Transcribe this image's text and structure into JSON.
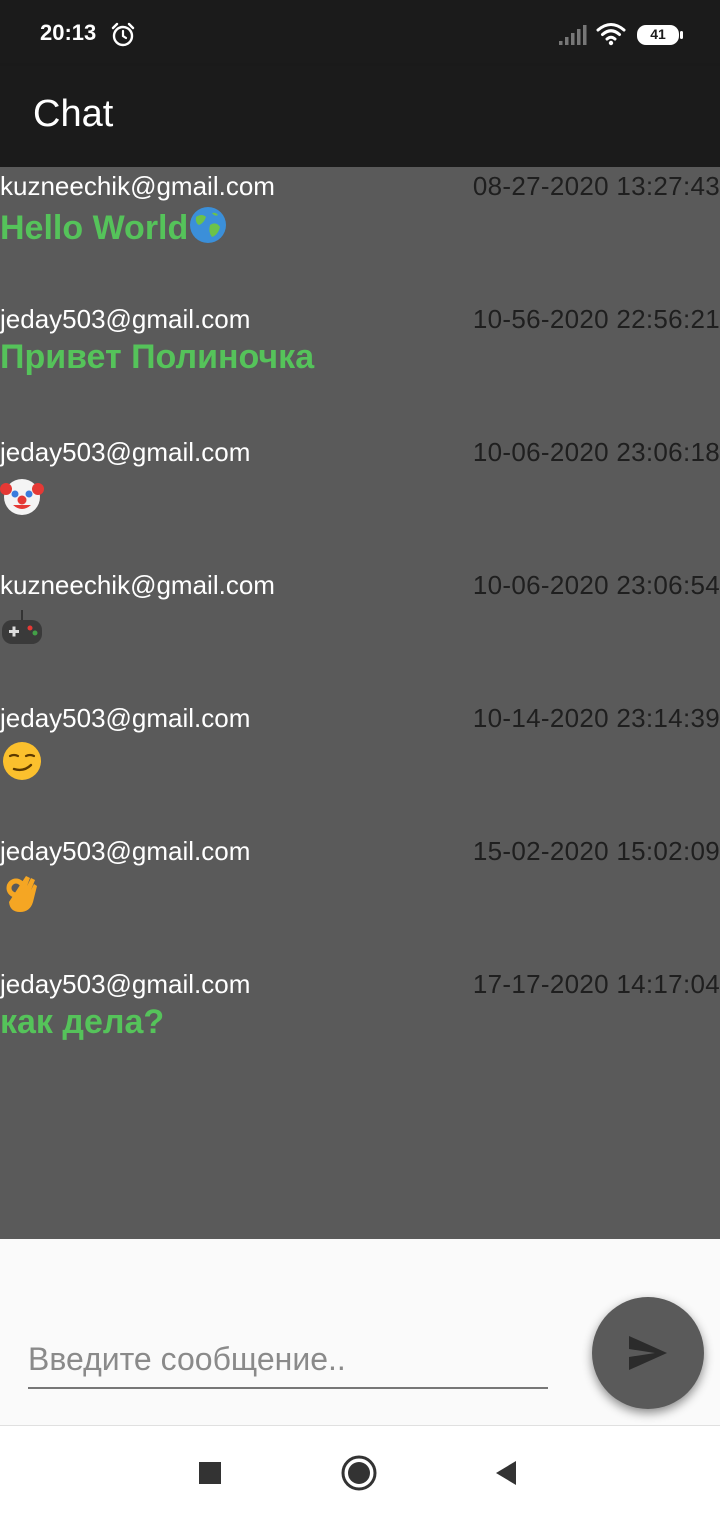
{
  "status_bar": {
    "time": "20:13",
    "battery": "41",
    "icons": [
      "alarm-icon",
      "signal-icon",
      "wifi-icon",
      "battery-icon"
    ]
  },
  "app_bar": {
    "title": "Chat"
  },
  "messages": [
    {
      "email": "kuzneechik@gmail.com",
      "time": "08-27-2020 13:27:43",
      "text": "Hello World",
      "emoji": "globe-icon"
    },
    {
      "email": "jeday503@gmail.com",
      "time": "10-56-2020 22:56:21",
      "text": "Привет Полиночка",
      "emoji": ""
    },
    {
      "email": "jeday503@gmail.com",
      "time": "10-06-2020 23:06:18",
      "text": "",
      "emoji": "clown-face-icon"
    },
    {
      "email": "kuzneechik@gmail.com",
      "time": "10-06-2020 23:06:54",
      "text": "",
      "emoji": "game-controller-icon"
    },
    {
      "email": "jeday503@gmail.com",
      "time": "10-14-2020 23:14:39",
      "text": "",
      "emoji": "smirk-face-icon"
    },
    {
      "email": "jeday503@gmail.com",
      "time": "15-02-2020 15:02:09",
      "text": "",
      "emoji": "ok-hand-icon"
    },
    {
      "email": "jeday503@gmail.com",
      "time": "17-17-2020 14:17:04",
      "text": "как дела?",
      "emoji": ""
    }
  ],
  "input": {
    "placeholder": "Введите сообщение..",
    "value": ""
  },
  "send_button": {
    "icon": "send-icon"
  },
  "nav_bar": {
    "icons": [
      "recents-icon",
      "home-icon",
      "back-icon"
    ]
  },
  "colors": {
    "app_bar": "#1b1b1b",
    "background": "#5a5a5a",
    "message_text": "#55c35a",
    "email_text": "#ffffff",
    "time_text": "#1f1f1f"
  }
}
